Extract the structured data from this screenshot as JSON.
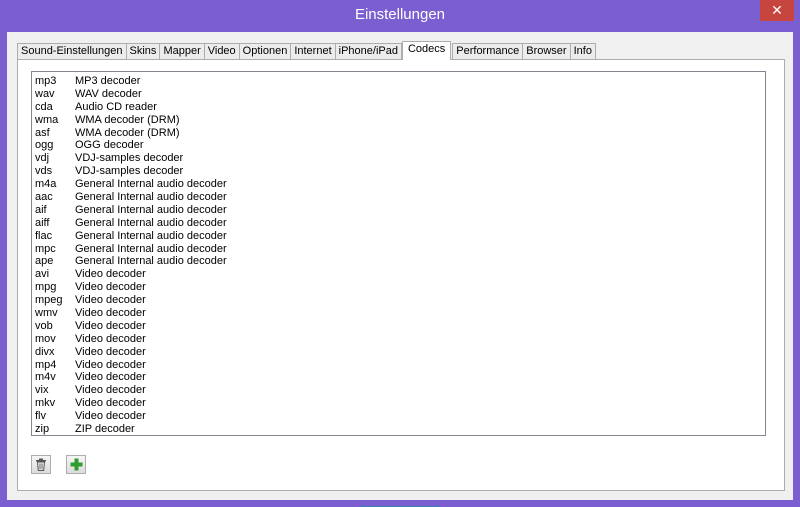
{
  "window": {
    "title": "Einstellungen",
    "close_label": "✕"
  },
  "tabs": [
    {
      "label": "Sound-Einstellungen"
    },
    {
      "label": "Skins"
    },
    {
      "label": "Mapper"
    },
    {
      "label": "Video"
    },
    {
      "label": "Optionen"
    },
    {
      "label": "Internet"
    },
    {
      "label": "iPhone/iPad"
    },
    {
      "label": "Codecs",
      "active": true
    },
    {
      "label": "Performance"
    },
    {
      "label": "Browser"
    },
    {
      "label": "Info"
    }
  ],
  "codecs": [
    {
      "ext": "mp3",
      "desc": "MP3 decoder"
    },
    {
      "ext": "wav",
      "desc": "WAV decoder"
    },
    {
      "ext": "cda",
      "desc": "Audio CD reader"
    },
    {
      "ext": "wma",
      "desc": "WMA decoder (DRM)"
    },
    {
      "ext": "asf",
      "desc": "WMA decoder (DRM)"
    },
    {
      "ext": "ogg",
      "desc": "OGG decoder"
    },
    {
      "ext": "vdj",
      "desc": "VDJ-samples decoder"
    },
    {
      "ext": "vds",
      "desc": "VDJ-samples decoder"
    },
    {
      "ext": "m4a",
      "desc": "General Internal audio decoder"
    },
    {
      "ext": "aac",
      "desc": "General Internal audio decoder"
    },
    {
      "ext": "aif",
      "desc": "General Internal audio decoder"
    },
    {
      "ext": "aiff",
      "desc": "General Internal audio decoder"
    },
    {
      "ext": "flac",
      "desc": "General Internal audio decoder"
    },
    {
      "ext": "mpc",
      "desc": "General Internal audio decoder"
    },
    {
      "ext": "ape",
      "desc": "General Internal audio decoder"
    },
    {
      "ext": "avi",
      "desc": "Video decoder"
    },
    {
      "ext": "mpg",
      "desc": "Video decoder"
    },
    {
      "ext": "mpeg",
      "desc": "Video decoder"
    },
    {
      "ext": "wmv",
      "desc": "Video decoder"
    },
    {
      "ext": "vob",
      "desc": "Video decoder"
    },
    {
      "ext": "mov",
      "desc": "Video decoder"
    },
    {
      "ext": "divx",
      "desc": "Video decoder"
    },
    {
      "ext": "mp4",
      "desc": "Video decoder"
    },
    {
      "ext": "m4v",
      "desc": "Video decoder"
    },
    {
      "ext": "vix",
      "desc": "Video decoder"
    },
    {
      "ext": "mkv",
      "desc": "Video decoder"
    },
    {
      "ext": "flv",
      "desc": "Video decoder"
    },
    {
      "ext": "zip",
      "desc": "ZIP decoder"
    }
  ],
  "toolbar": {
    "delete_icon": "trash-icon",
    "add_icon": "plus-icon"
  },
  "colors": {
    "titlebar": "#7b5fd1",
    "close": "#c7453f",
    "add_green": "#2e9d2e"
  }
}
